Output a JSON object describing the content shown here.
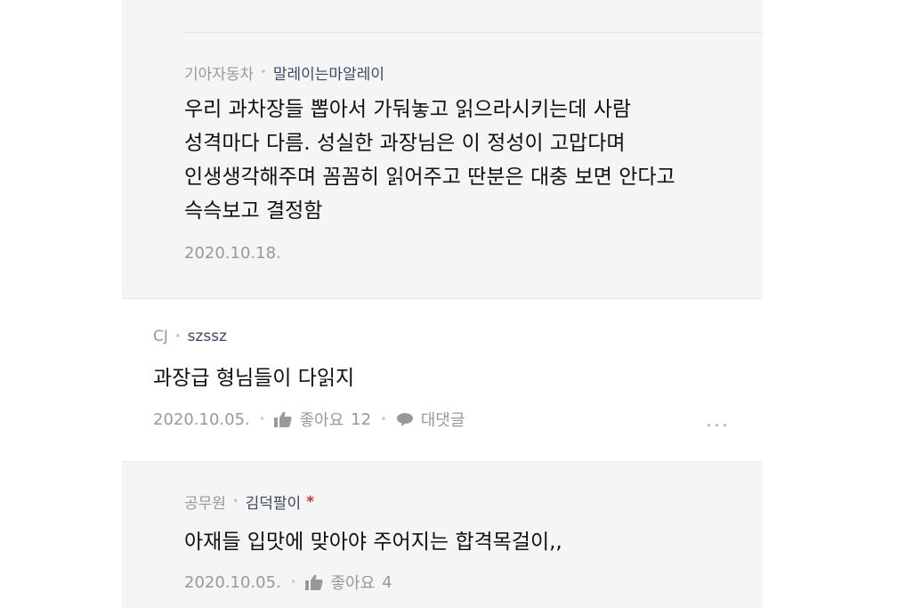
{
  "comments": [
    {
      "company": "기아자동차",
      "nickname": "말레이는마알레이",
      "lines": [
        "우리 과차장들 뽑아서 가둬놓고 읽으라시키는데 사람",
        "성격마다 다름. 성실한 과장님은 이 정성이 고맙다며",
        "인생생각해주며 꼼꼼히 읽어주고 딴분은 대충 보면 안다고",
        "슥슥보고 결정함"
      ],
      "date": "2020.10.18."
    },
    {
      "company": "CJ",
      "nickname": "szssz",
      "text": "과장급 형님들이 다읽지",
      "date": "2020.10.05.",
      "like_label": "좋아요",
      "like_count": "12",
      "reply_label": "대댓글",
      "more": "..."
    },
    {
      "company": "공무원",
      "nickname": "김덕팔이",
      "badge": "*",
      "text": "아재들 입맛에 맞아야 주어지는 합격목걸이,,",
      "date": "2020.10.05.",
      "like_label": "좋아요",
      "like_count": "4"
    }
  ],
  "colors": {
    "reply_bg": "#f5f5f5",
    "nickname": "#3b4a63",
    "badge": "#e0302b"
  }
}
